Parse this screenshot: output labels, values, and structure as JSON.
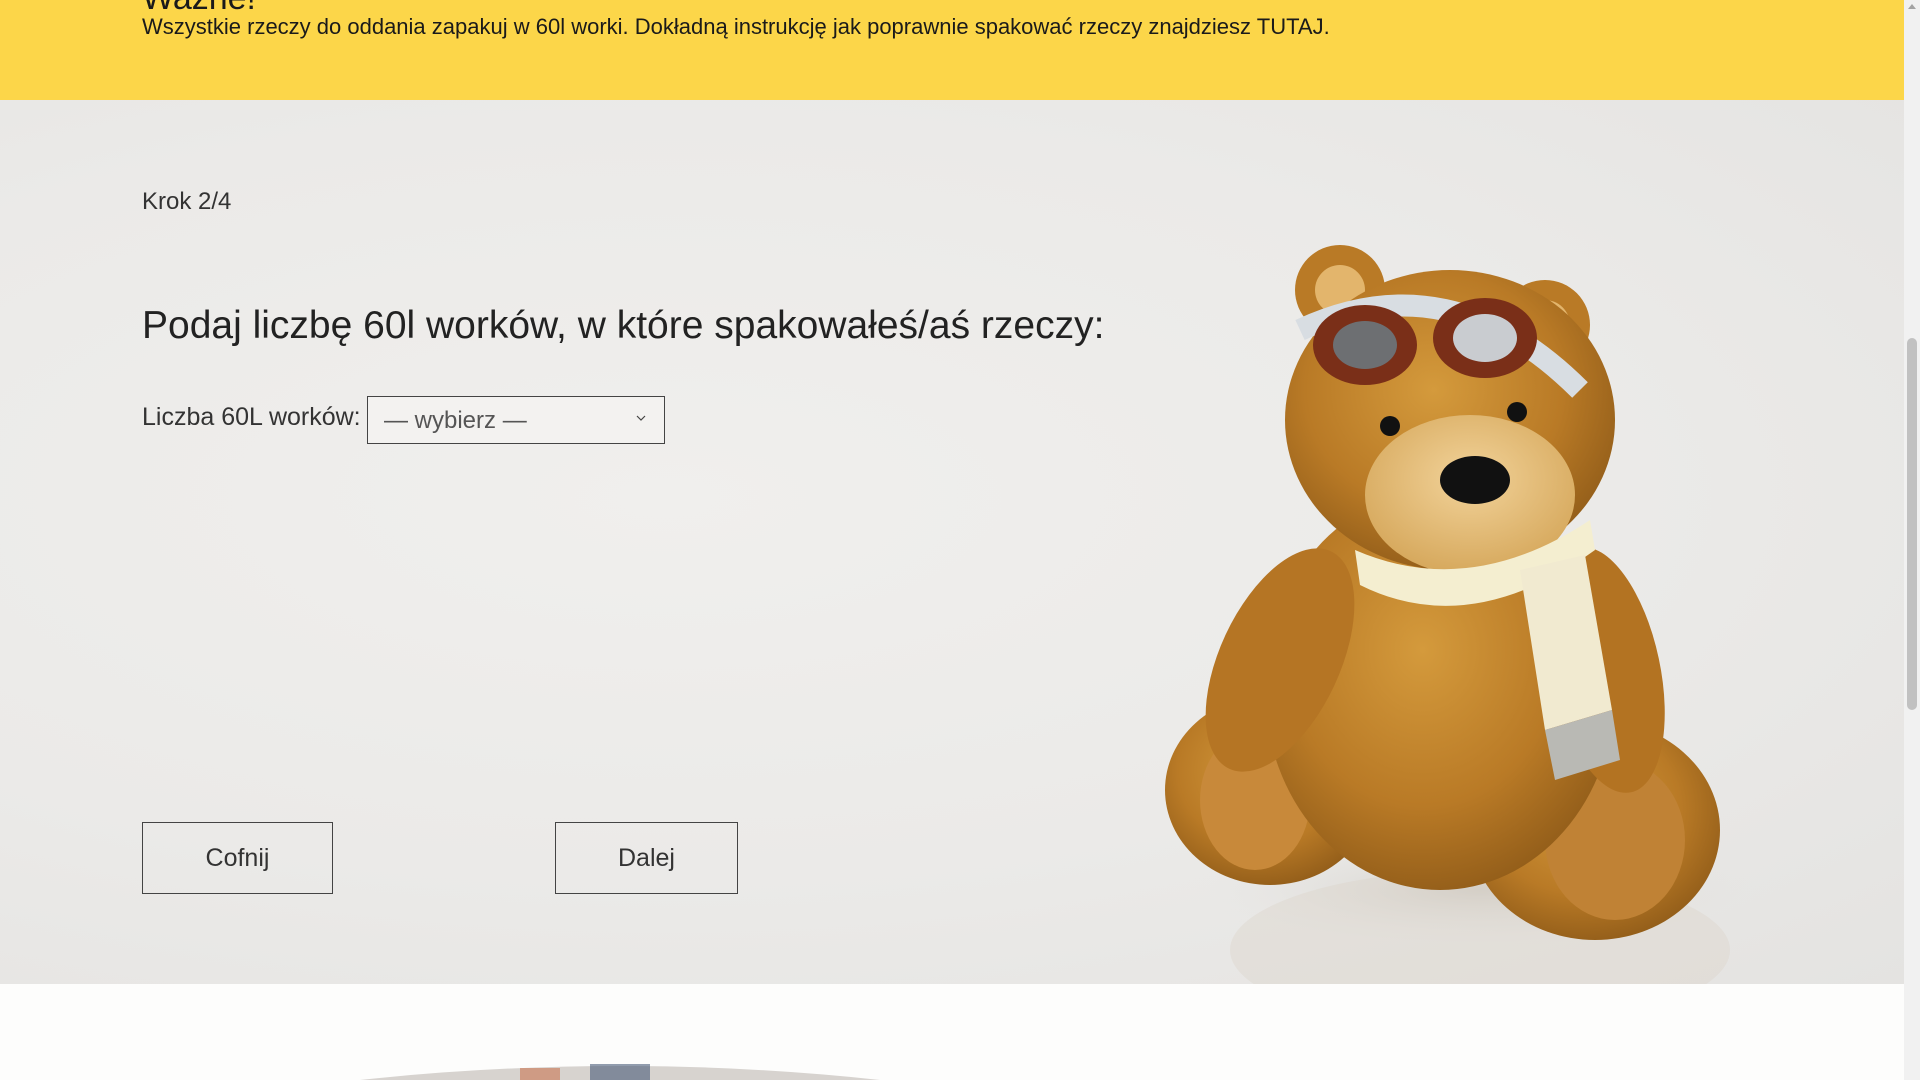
{
  "notice": {
    "title": "Ważne!",
    "text": "Wszystkie rzeczy do oddania zapakuj w 60l worki. Dokładną instrukcję jak poprawnie spakować rzeczy znajdziesz TUTAJ."
  },
  "step": {
    "label": "Krok 2/4",
    "question": "Podaj liczbę 60l worków, w które spakowałeś/aś rzeczy:",
    "field_label": "Liczba 60L worków:",
    "select_value": "— wybierz —"
  },
  "buttons": {
    "back": "Cofnij",
    "next": "Dalej"
  },
  "colors": {
    "banner": "#fcd649",
    "section_bg": "#ebeae8",
    "border": "#444444"
  },
  "icons": {
    "select_arrow": "chevron-down-icon",
    "illustration": "teddy-bear-image"
  }
}
